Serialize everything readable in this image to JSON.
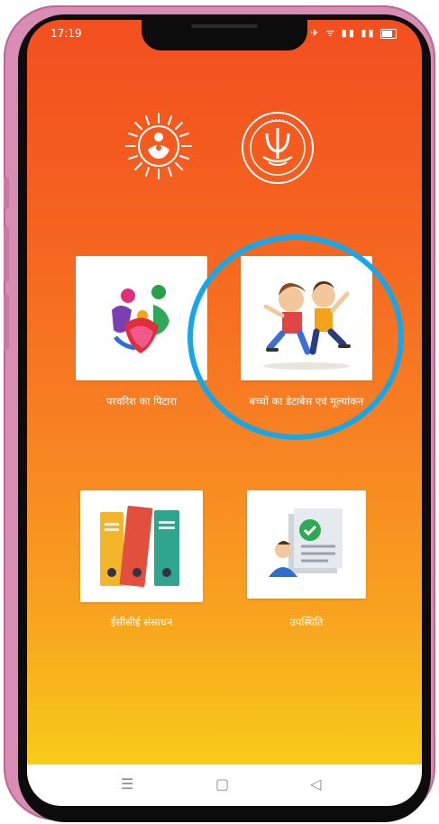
{
  "status": {
    "time": "17:19",
    "icons": "✈ ᯤ ▮▮ ▮▮"
  },
  "logos": {
    "left": "sun-family-logo",
    "right": "up-government-emblem"
  },
  "tiles": [
    {
      "label": "परवरिश का पिटारा",
      "icon": "family-hearts-icon"
    },
    {
      "label": "बच्चों का डेटाबेस एवं मूल्यांकन",
      "icon": "children-running-icon"
    },
    {
      "label": "ईसीसीई संसाधन",
      "icon": "binders-icon"
    },
    {
      "label": "उपस्थिति",
      "icon": "attendance-icon"
    }
  ],
  "nav": {
    "menu": "☰",
    "home": "▢",
    "back": "◁"
  },
  "colors": {
    "top": "#f24f1f",
    "bottom": "#f8d417",
    "ring": "#19a6e8"
  }
}
